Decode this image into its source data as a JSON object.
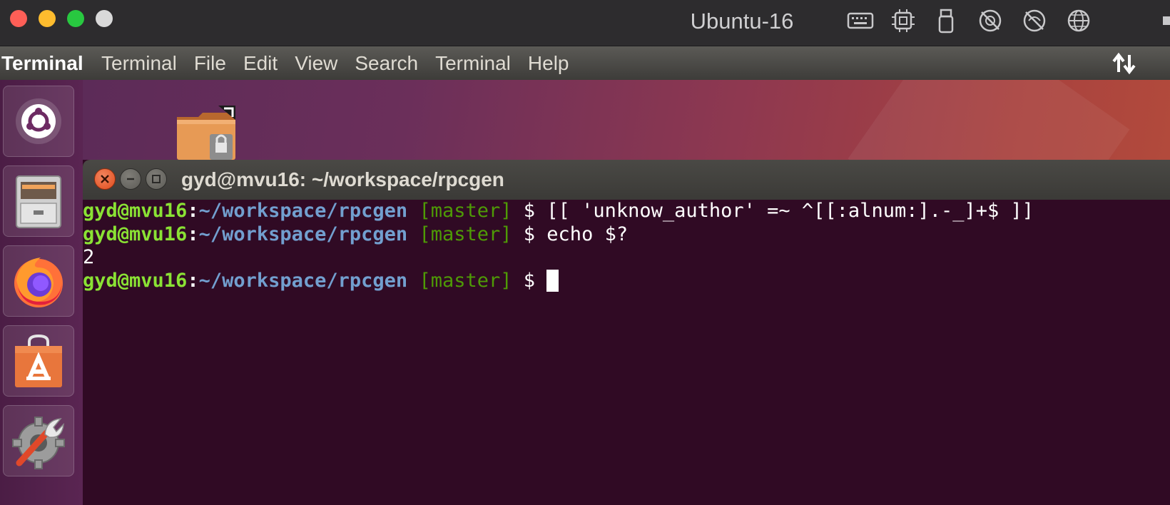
{
  "host": {
    "window_title": "Ubuntu-16",
    "toolbar_icons": [
      "keyboard-icon",
      "cpu-icon",
      "usb-icon",
      "camera-disabled-icon",
      "microphone-disabled-icon",
      "network-globe-icon"
    ]
  },
  "panel": {
    "app_name": "Terminal",
    "menu": [
      "Terminal",
      "File",
      "Edit",
      "View",
      "Search",
      "Terminal",
      "Help"
    ],
    "indicator_icon": "network-arrows-icon"
  },
  "launcher": {
    "items": [
      "ubuntu-dash-icon",
      "files-icon",
      "firefox-icon",
      "software-center-icon",
      "system-settings-icon"
    ]
  },
  "desktop": {
    "icons": [
      "shared-folder-icon"
    ]
  },
  "terminal": {
    "title": "gyd@mvu16: ~/workspace/rpcgen",
    "prompt": {
      "user_host": "gyd@mvu16",
      "colon": ":",
      "path": "~/workspace/rpcgen",
      "branch": "[master]",
      "symbol": "$"
    },
    "lines": [
      {
        "type": "command",
        "command": "[[ 'unknow_author' =~ ^[[:alnum:].-_]+$ ]]"
      },
      {
        "type": "command",
        "command": "echo $?"
      },
      {
        "type": "output",
        "text": "2"
      },
      {
        "type": "command",
        "command": ""
      }
    ]
  },
  "colors": {
    "terminal_bg": "#300a24",
    "prompt_user": "#8ae234",
    "prompt_path": "#729fcf",
    "prompt_branch": "#4e9a06",
    "close_button": "#df4b1c"
  }
}
